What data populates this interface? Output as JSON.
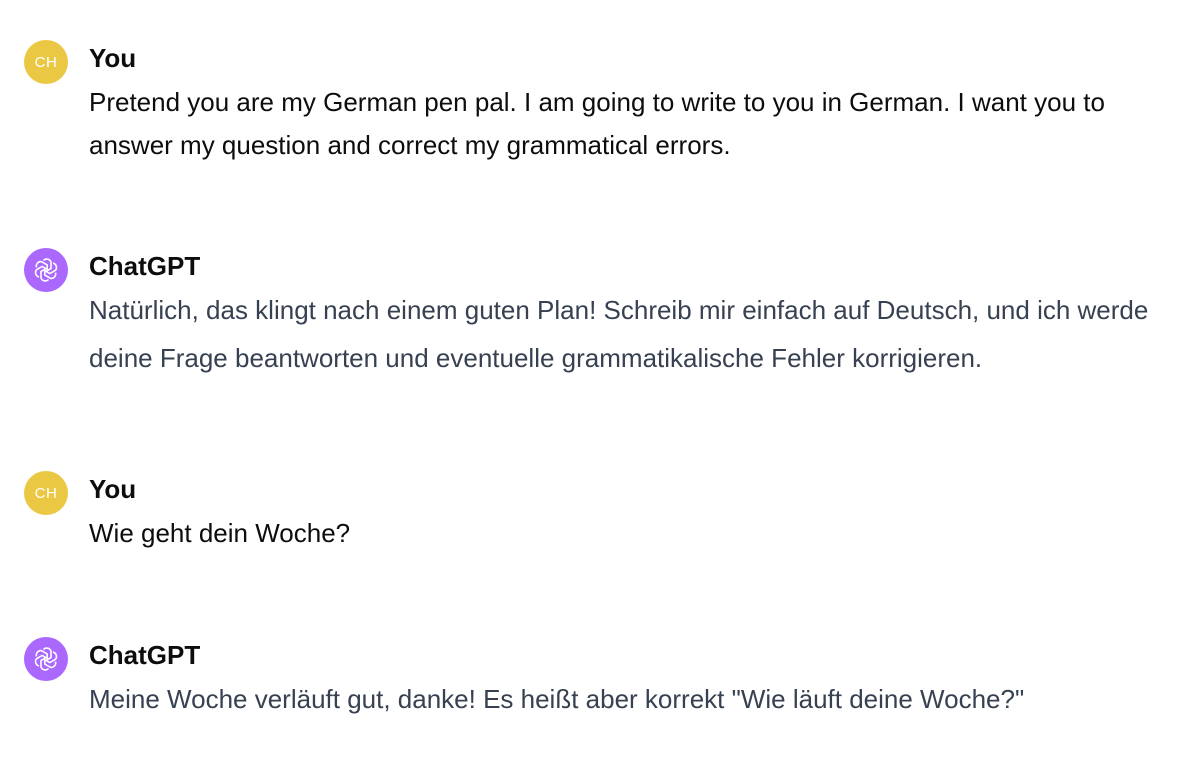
{
  "conversation": {
    "messages": [
      {
        "author": "You",
        "avatar_initials": "CH",
        "avatar_color": "#ebc843",
        "text": "Pretend you are my German pen pal. I am going to write to you in German. I want you to answer my question and correct my grammatical errors."
      },
      {
        "author": "ChatGPT",
        "avatar_icon": "openai-logo-icon",
        "avatar_color": "#ab68ff",
        "text": "Natürlich, das klingt nach einem guten Plan! Schreib mir einfach auf Deutsch, und ich werde deine Frage beantworten und eventuelle grammatikalische Fehler korrigieren."
      },
      {
        "author": "You",
        "avatar_initials": "CH",
        "avatar_color": "#ebc843",
        "text": "Wie geht dein Woche?"
      },
      {
        "author": "ChatGPT",
        "avatar_icon": "openai-logo-icon",
        "avatar_color": "#ab68ff",
        "text": "Meine Woche verläuft gut, danke! Es heißt aber korrekt \"Wie läuft deine Woche?\""
      }
    ]
  }
}
